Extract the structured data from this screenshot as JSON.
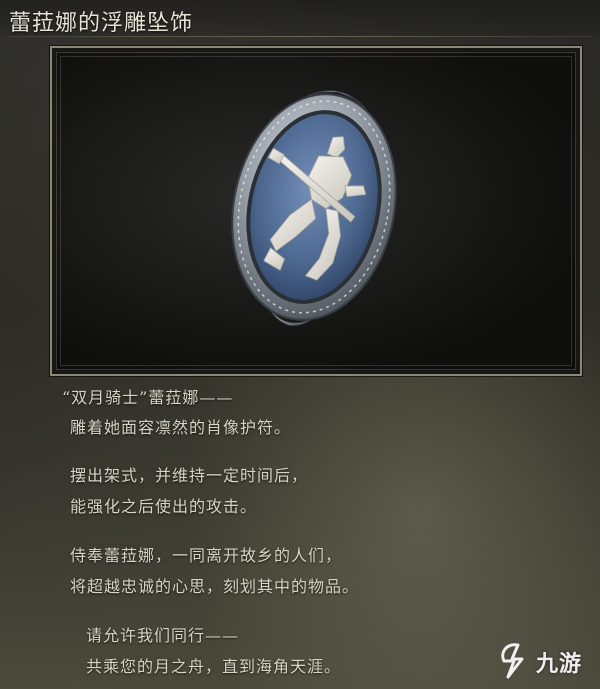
{
  "item": {
    "name": "蕾菈娜的浮雕坠饰",
    "image_icon": "blue-cameo-knight-pendant-icon"
  },
  "description": [
    "“双月骑士”蕾菈娜——",
    "雕着她面容凛然的肖像护符。",
    "摆出架式，并维持一定时间后，",
    "能强化之后使出的攻击。",
    "侍奉蕾菈娜，一同离开故乡的人们，",
    "将超越忠诚的心思，刻划其中的物品。",
    "请允许我们同行——",
    "共乘您的月之舟，直到海角天涯。"
  ],
  "watermark": {
    "text": "九游",
    "icon": "jiuyou-logo-icon"
  },
  "colors": {
    "cameo_blue": "#4f6a92",
    "cameo_ivory": "#e4e1d8",
    "frame_silver": "#9aa1aa",
    "text": "#d7d3c5"
  }
}
